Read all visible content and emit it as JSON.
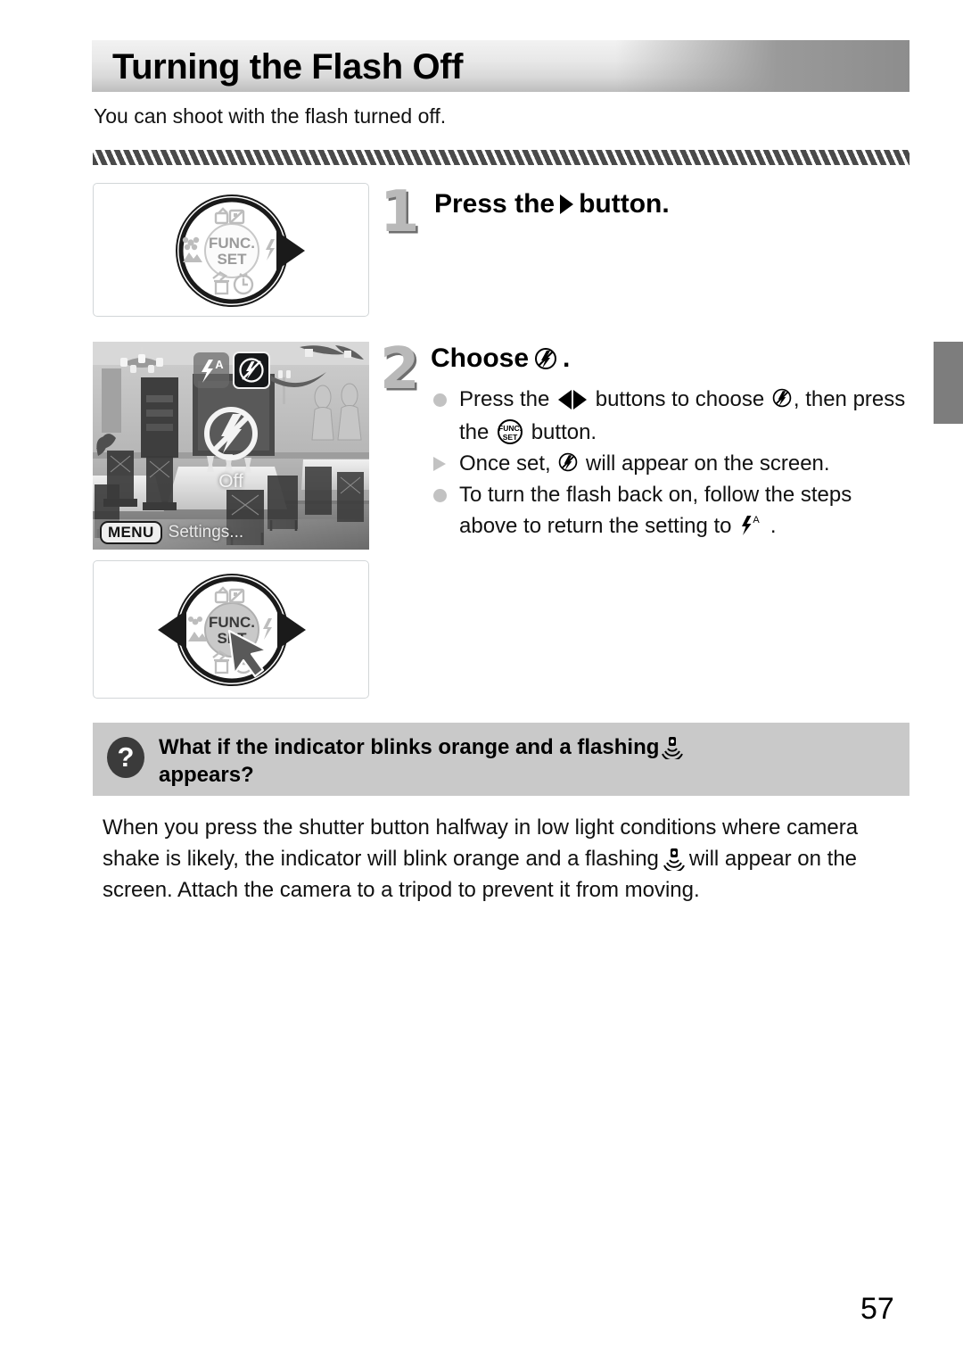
{
  "page": {
    "title": "Turning the Flash Off",
    "intro": "You can shoot with the flash turned off.",
    "number": "57"
  },
  "steps": [
    {
      "number": "1",
      "heading_before": "Press the",
      "heading_icon": "arrow-right-button-icon",
      "heading_after": "button.",
      "figure": {
        "name": "control-wheel-right-press",
        "center_label_top": "FUNC.",
        "center_label_bottom": "SET"
      }
    },
    {
      "number": "2",
      "heading_before": "Choose",
      "heading_icon": "flash-off-icon",
      "heading_after": ".",
      "bullets": [
        {
          "marker": "dot",
          "parts": [
            {
              "t": "text",
              "v": "Press the "
            },
            {
              "t": "icon",
              "v": "left-right-buttons-icon"
            },
            {
              "t": "text",
              "v": " buttons to choose "
            },
            {
              "t": "icon",
              "v": "flash-off-icon"
            },
            {
              "t": "text",
              "v": ", then press the "
            },
            {
              "t": "icon",
              "v": "func-set-button-icon"
            },
            {
              "t": "text",
              "v": " button."
            }
          ]
        },
        {
          "marker": "triangle",
          "parts": [
            {
              "t": "text",
              "v": "Once set, "
            },
            {
              "t": "icon",
              "v": "flash-off-icon"
            },
            {
              "t": "text",
              "v": " will appear on the screen."
            }
          ]
        },
        {
          "marker": "dot",
          "parts": [
            {
              "t": "text",
              "v": "To turn the flash back on, follow the steps above to return the setting to "
            },
            {
              "t": "icon",
              "v": "flash-auto-icon"
            },
            {
              "t": "text",
              "v": " ."
            }
          ]
        }
      ],
      "figure": {
        "name": "control-wheel-func-set-press",
        "center_label_top": "FUNC.",
        "center_label_bottom": "SET"
      }
    }
  ],
  "lcd": {
    "badge_auto": "flash-auto-icon",
    "badge_off": "flash-off-icon",
    "big_icon": "flash-off-large-icon",
    "mode_label": "Off",
    "menu_badge": "MENU",
    "menu_label": "Settings..."
  },
  "qa": {
    "icon": "question-mark-icon",
    "title_before": "What if the indicator blinks orange and a flashing",
    "title_icon": "camera-shake-icon",
    "title_after": "appears?",
    "body_part1": "When you press the shutter button halfway in low light conditions where camera shake is likely, the indicator will blink orange and a flashing",
    "body_icon": "camera-shake-icon",
    "body_part2": "will appear on the screen. Attach the camera to a tripod to prevent it from moving."
  },
  "colors": {
    "banner_light": "#f2f2f2",
    "banner_dark": "#8d8d8d",
    "qa_background": "#c9c9c9",
    "step_number": "#b9b9b9",
    "step_number_shadow": "#6f6f6f",
    "edge_tab": "#7d7d7d",
    "bullet": "#c2c2c2"
  }
}
